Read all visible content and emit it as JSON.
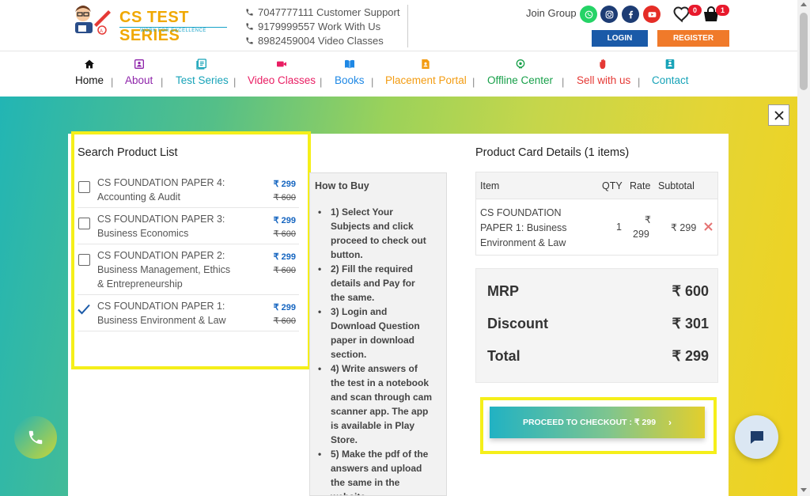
{
  "header": {
    "logo": {
      "title": "CS TEST SERIES",
      "tagline": "WORK FOR EXCELLENCE"
    },
    "contacts": [
      {
        "label": "7047777111 Customer Support"
      },
      {
        "label": "9179999557 Work With Us"
      },
      {
        "label": "8982459004 Video Classes"
      }
    ],
    "join_group_label": "Join Group",
    "social_icons": [
      "whatsapp-icon",
      "instagram-icon",
      "facebook-icon",
      "youtube-icon"
    ],
    "wishlist_count": "0",
    "cart_count": "1",
    "login_label": "LOGIN",
    "register_label": "REGISTER",
    "colors": {
      "login": "#1a5aa8",
      "register": "#f07a2a",
      "badge": "#e8192c"
    }
  },
  "nav": {
    "items": [
      {
        "label": "Home",
        "color": "#111111",
        "icon": "home-icon"
      },
      {
        "label": "About",
        "color": "#8e24aa",
        "icon": "id-card-icon"
      },
      {
        "label": "Test Series",
        "color": "#17a3b8",
        "icon": "list-icon"
      },
      {
        "label": "Video Classes",
        "color": "#e91e63",
        "icon": "video-camera-icon"
      },
      {
        "label": "Books",
        "color": "#1e88e5",
        "icon": "book-icon"
      },
      {
        "label": "Placement Portal",
        "color": "#f39c12",
        "icon": "document-user-icon"
      },
      {
        "label": "Offline Center",
        "color": "#18a04a",
        "icon": "location-pin-icon"
      },
      {
        "label": "Sell with us",
        "color": "#e53935",
        "icon": "hand-icon"
      },
      {
        "label": "Contact",
        "color": "#17a3b8",
        "icon": "contact-card-icon"
      }
    ],
    "separator": "|"
  },
  "product_list": {
    "title": "Search Product List",
    "items": [
      {
        "line1": "CS FOUNDATION PAPER 4:",
        "line2": "Accounting & Audit",
        "line3": "",
        "price": "₹ 299",
        "old_price": "₹ 600",
        "checked": false
      },
      {
        "line1": "CS FOUNDATION PAPER 3:",
        "line2": "Business Economics",
        "line3": "",
        "price": "₹ 299",
        "old_price": "₹ 600",
        "checked": false
      },
      {
        "line1": "CS FOUNDATION PAPER 2:",
        "line2": "Business Management, Ethics",
        "line3": "& Entrepreneurship",
        "price": "₹ 299",
        "old_price": "₹ 600",
        "checked": false
      },
      {
        "line1": "CS FOUNDATION PAPER 1:",
        "line2": "Business Environment & Law",
        "line3": "",
        "price": "₹ 299",
        "old_price": "₹ 600",
        "checked": true
      }
    ]
  },
  "how_to_buy": {
    "title": "How to Buy",
    "steps": [
      [
        "1) Select Your",
        "Subjects and click",
        "proceed to check out",
        "button."
      ],
      [
        "2) Fill the required",
        "details and Pay for",
        "the same."
      ],
      [
        "3) Login and",
        "Download Question",
        "paper in download",
        "section."
      ],
      [
        "4) Write answers of",
        "the test in a notebook",
        "and scan through cam",
        "scanner app. The app",
        "is available in Play",
        "Store."
      ],
      [
        "5) Make the pdf of the",
        "answers and upload",
        "the same in the",
        "website."
      ]
    ]
  },
  "cart": {
    "title": "Product Card Details (1 items)",
    "headers": {
      "item": "Item",
      "qty": "QTY",
      "rate": "Rate",
      "subtotal": "Subtotal"
    },
    "row": {
      "item_lines": [
        "CS FOUNDATION",
        "PAPER 1: Business",
        "Environment & Law"
      ],
      "qty": "1",
      "rate_symbol": "₹",
      "rate_value": "299",
      "subtotal": "₹ 299"
    },
    "totals": {
      "mrp_label": "MRP",
      "mrp_value": "₹ 600",
      "discount_label": "Discount",
      "discount_value": "₹ 301",
      "total_label": "Total",
      "total_value": "₹ 299"
    },
    "checkout_label": "PROCEED TO CHECKOUT : ₹ 299",
    "checkout_chevron": "›"
  }
}
